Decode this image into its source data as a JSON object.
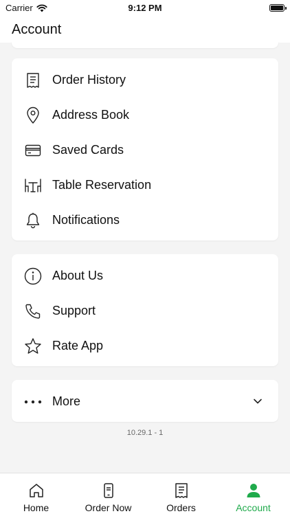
{
  "status_bar": {
    "carrier": "Carrier",
    "time": "9:12 PM"
  },
  "header": {
    "title": "Account"
  },
  "menu_group_1": [
    {
      "label": "Order History",
      "icon": "receipt-icon"
    },
    {
      "label": "Address Book",
      "icon": "map-pin-icon"
    },
    {
      "label": "Saved Cards",
      "icon": "credit-card-icon"
    },
    {
      "label": "Table Reservation",
      "icon": "table-chairs-icon"
    },
    {
      "label": "Notifications",
      "icon": "bell-icon"
    }
  ],
  "menu_group_2": [
    {
      "label": "About Us",
      "icon": "info-icon"
    },
    {
      "label": "Support",
      "icon": "phone-icon"
    },
    {
      "label": "Rate App",
      "icon": "star-icon"
    }
  ],
  "more": {
    "label": "More",
    "icon": "ellipsis-icon"
  },
  "version": "10.29.1 - 1",
  "tab_bar": {
    "tabs": [
      {
        "label": "Home",
        "icon": "home-icon",
        "active": false
      },
      {
        "label": "Order Now",
        "icon": "order-phone-icon",
        "active": false
      },
      {
        "label": "Orders",
        "icon": "receipt-icon",
        "active": false
      },
      {
        "label": "Account",
        "icon": "person-icon",
        "active": true
      }
    ],
    "active_color": "#1faa4b",
    "inactive_color": "#111111"
  }
}
